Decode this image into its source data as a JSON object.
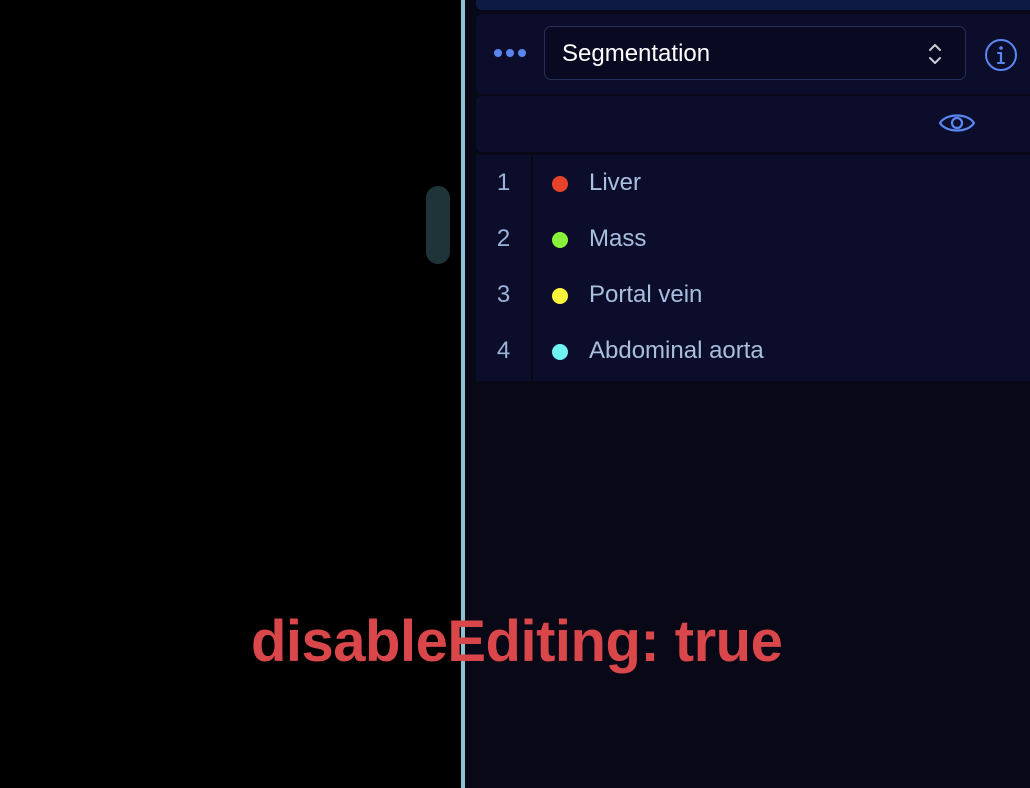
{
  "segmentation_panel": {
    "selected_segmentation": "Segmentation",
    "segments": [
      {
        "index": "1",
        "label": "Liver",
        "color": "#e8412b"
      },
      {
        "index": "2",
        "label": "Mass",
        "color": "#8cf13b"
      },
      {
        "index": "3",
        "label": "Portal vein",
        "color": "#f9f53a"
      },
      {
        "index": "4",
        "label": "Abdominal aorta",
        "color": "#6ff4f4"
      }
    ]
  },
  "icons": {
    "menu": "more-dots-icon",
    "select": "chevron-updown-icon",
    "info": "info-icon",
    "visibility": "eye-icon"
  },
  "overlay": {
    "text": "disableEditing: true"
  },
  "colors": {
    "accent": "#5a86f2",
    "panel_bg": "#0c0d2b",
    "divider": "#8fc1d4",
    "overlay_text": "#d9474a"
  }
}
